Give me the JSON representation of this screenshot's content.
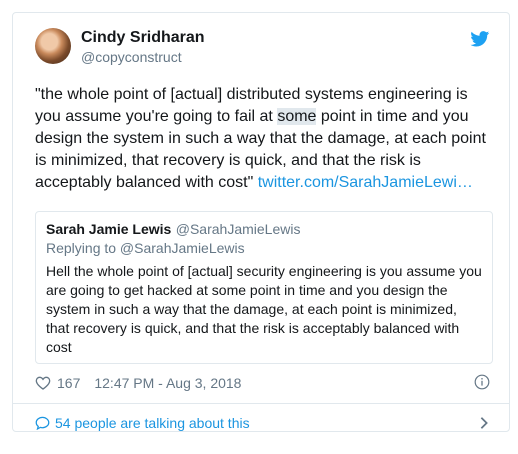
{
  "author": {
    "name": "Cindy Sridharan",
    "handle": "@copyconstruct"
  },
  "tweet": {
    "text_before": "\"the whole point of [actual] distributed systems engineering is you assume you're going to fail at ",
    "text_highlight": "some",
    "text_after": " point in time and you design the system in such a way that the damage, at each point is minimized, that recovery is quick, and that the risk is acceptably balanced with cost\" ",
    "link": "twitter.com/SarahJamieLewi…"
  },
  "quoted": {
    "name": "Sarah Jamie Lewis",
    "handle": "@SarahJamieLewis",
    "replying": "Replying to @SarahJamieLewis",
    "text": "Hell the whole point of [actual] security engineering is you assume you are going to get hacked at some point in time and you design the system in such a way that the damage, at each point is minimized, that recovery is quick, and that the risk is acceptably balanced with cost"
  },
  "meta": {
    "likes": "167",
    "timestamp": "12:47 PM - Aug 3, 2018"
  },
  "footer": {
    "talking": "54 people are talking about this"
  },
  "icons": {
    "brand": "twitter-bird-icon",
    "like": "heart-icon",
    "info": "info-icon",
    "conversation": "speech-bubble-icon",
    "chevron": "chevron-right-icon"
  },
  "colors": {
    "brand": "#1da1f2",
    "link": "#1b95e0",
    "muted": "#657786",
    "border": "#e1e8ed"
  }
}
